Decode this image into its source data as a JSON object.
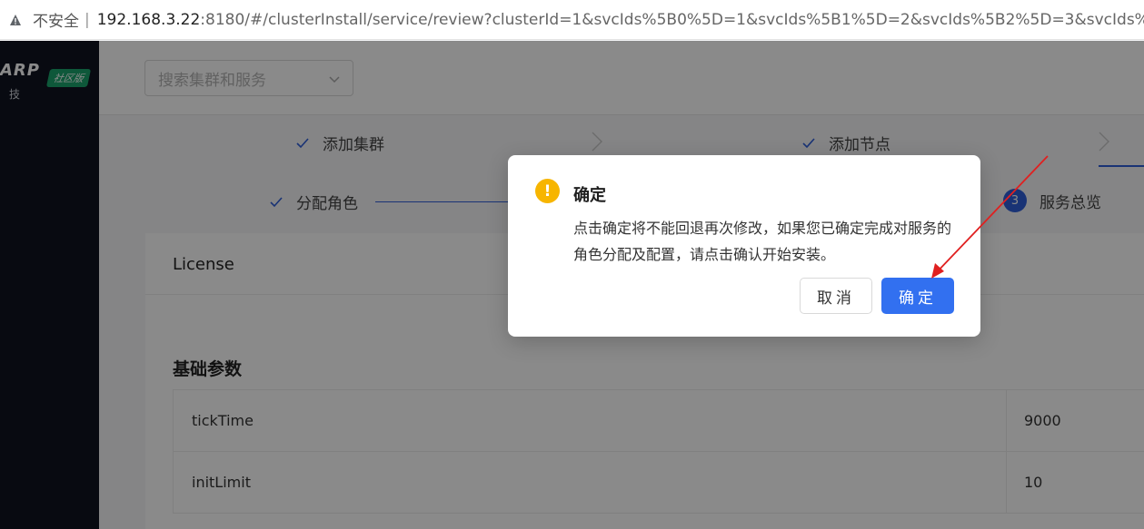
{
  "browser": {
    "insecure_label": "不安全",
    "separator": "|",
    "url_host": "192.168.3.22",
    "url_rest": ":8180/#/clusterInstall/service/review?clusterId=1&svcIds%5B0%5D=1&svcIds%5B1%5D=2&svcIds%5B2%5D=3&svcIds%5B3"
  },
  "sidebar": {
    "logo_text": "ARP",
    "logo_sub": "技",
    "edition_badge": "社区版"
  },
  "topbar": {
    "search_placeholder": "搜索集群和服务"
  },
  "steps_top": [
    {
      "label": "添加集群",
      "state": "done"
    },
    {
      "label": "添加节点",
      "state": "done"
    }
  ],
  "steps_sub": [
    {
      "label": "分配角色",
      "state": "done"
    },
    {
      "label": "服务总览",
      "state": "active",
      "number": "3"
    }
  ],
  "card": {
    "header": "License",
    "section_title": "基础参数",
    "params": [
      {
        "key": "tickTime",
        "value": "9000"
      },
      {
        "key": "initLimit",
        "value": "10"
      }
    ]
  },
  "dialog": {
    "title": "确定",
    "message": "点击确定将不能回退再次修改，如果您已确定完成对服务的角色分配及配置，请点击确认开始安装。",
    "cancel_label": "取消",
    "ok_label": "确定",
    "warn_glyph": "!"
  },
  "colors": {
    "primary": "#3270f0",
    "warning": "#f7b500",
    "sidebar_bg": "#0f1420",
    "annotation": "#e02020"
  }
}
